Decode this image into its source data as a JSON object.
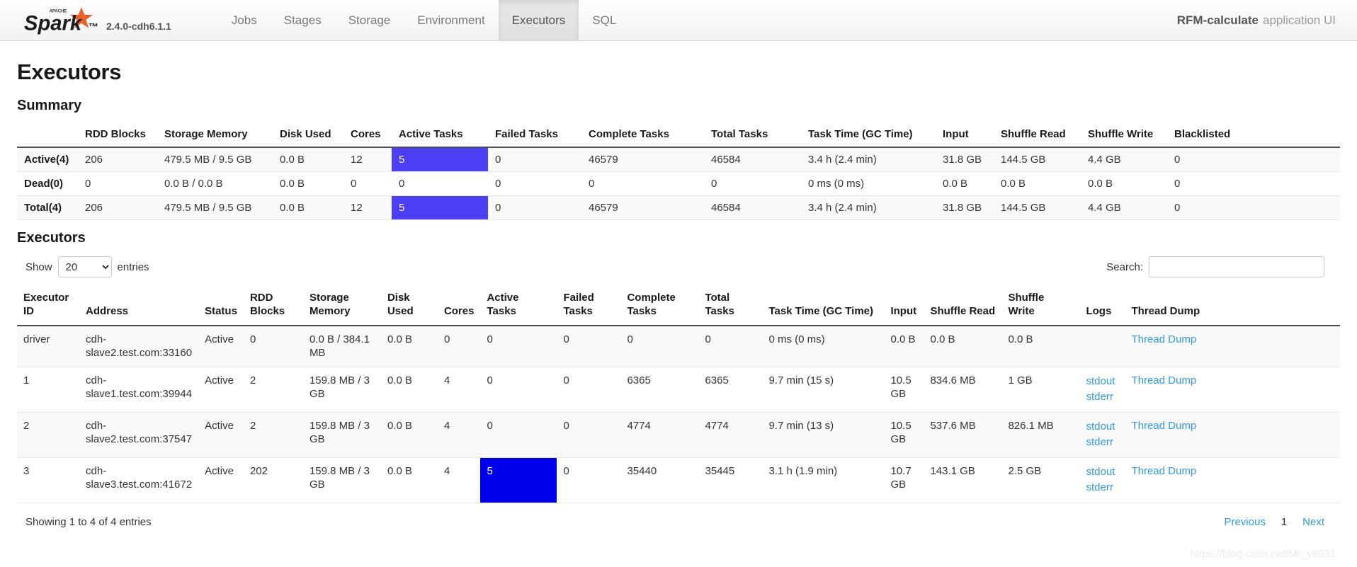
{
  "navbar": {
    "logo_alt": "Apache Spark",
    "logo_top_text": "APACHE",
    "logo_text": "Spark",
    "version": "2.4.0-cdh6.1.1",
    "items": [
      {
        "label": "Jobs",
        "active": false
      },
      {
        "label": "Stages",
        "active": false
      },
      {
        "label": "Storage",
        "active": false
      },
      {
        "label": "Environment",
        "active": false
      },
      {
        "label": "Executors",
        "active": true
      },
      {
        "label": "SQL",
        "active": false
      }
    ],
    "app_name": "RFM-calculate",
    "app_suffix": "application UI"
  },
  "page": {
    "title": "Executors",
    "summary_title": "Summary",
    "executors_title": "Executors"
  },
  "summary": {
    "headers": [
      "",
      "RDD Blocks",
      "Storage Memory",
      "Disk Used",
      "Cores",
      "Active Tasks",
      "Failed Tasks",
      "Complete Tasks",
      "Total Tasks",
      "Task Time (GC Time)",
      "Input",
      "Shuffle Read",
      "Shuffle Write",
      "Blacklisted"
    ],
    "rows": [
      {
        "label": "Active(4)",
        "rdd_blocks": "206",
        "storage_memory": "479.5 MB / 9.5 GB",
        "disk_used": "0.0 B",
        "cores": "12",
        "active_tasks": "5",
        "active_tasks_highlight": true,
        "failed_tasks": "0",
        "complete_tasks": "46579",
        "total_tasks": "46584",
        "task_time": "3.4 h (2.4 min)",
        "input": "31.8 GB",
        "shuffle_read": "144.5 GB",
        "shuffle_write": "4.4 GB",
        "blacklisted": "0"
      },
      {
        "label": "Dead(0)",
        "rdd_blocks": "0",
        "storage_memory": "0.0 B / 0.0 B",
        "disk_used": "0.0 B",
        "cores": "0",
        "active_tasks": "0",
        "active_tasks_highlight": false,
        "failed_tasks": "0",
        "complete_tasks": "0",
        "total_tasks": "0",
        "task_time": "0 ms (0 ms)",
        "input": "0.0 B",
        "shuffle_read": "0.0 B",
        "shuffle_write": "0.0 B",
        "blacklisted": "0"
      },
      {
        "label": "Total(4)",
        "rdd_blocks": "206",
        "storage_memory": "479.5 MB / 9.5 GB",
        "disk_used": "0.0 B",
        "cores": "12",
        "active_tasks": "5",
        "active_tasks_highlight": true,
        "failed_tasks": "0",
        "complete_tasks": "46579",
        "total_tasks": "46584",
        "task_time": "3.4 h (2.4 min)",
        "input": "31.8 GB",
        "shuffle_read": "144.5 GB",
        "shuffle_write": "4.4 GB",
        "blacklisted": "0"
      }
    ]
  },
  "controls": {
    "show_label": "Show",
    "entries_label": "entries",
    "page_length_selected": "20",
    "page_length_options": [
      "20",
      "40",
      "60",
      "100"
    ],
    "search_label": "Search:",
    "search_value": "",
    "search_placeholder": ""
  },
  "executors": {
    "headers": [
      "Executor ID",
      "Address",
      "Status",
      "RDD Blocks",
      "Storage Memory",
      "Disk Used",
      "Cores",
      "Active Tasks",
      "Failed Tasks",
      "Complete Tasks",
      "Total Tasks",
      "Task Time (GC Time)",
      "Input",
      "Shuffle Read",
      "Shuffle Write",
      "Logs",
      "Thread Dump"
    ],
    "rows": [
      {
        "id": "driver",
        "address": "cdh-slave2.test.com:33160",
        "status": "Active",
        "rdd_blocks": "0",
        "storage_memory": "0.0 B / 384.1 MB",
        "disk_used": "0.0 B",
        "cores": "0",
        "active_tasks": "0",
        "active_tasks_highlight": false,
        "failed_tasks": "0",
        "complete_tasks": "0",
        "total_tasks": "0",
        "task_time": "0 ms (0 ms)",
        "input": "0.0 B",
        "shuffle_read": "0.0 B",
        "shuffle_write": "0.0 B",
        "logs": [],
        "thread_dump": "Thread Dump"
      },
      {
        "id": "1",
        "address": "cdh-slave1.test.com:39944",
        "status": "Active",
        "rdd_blocks": "2",
        "storage_memory": "159.8 MB / 3 GB",
        "disk_used": "0.0 B",
        "cores": "4",
        "active_tasks": "0",
        "active_tasks_highlight": false,
        "failed_tasks": "0",
        "complete_tasks": "6365",
        "total_tasks": "6365",
        "task_time": "9.7 min (15 s)",
        "input": "10.5 GB",
        "shuffle_read": "834.6 MB",
        "shuffle_write": "1 GB",
        "logs": [
          "stdout",
          "stderr"
        ],
        "thread_dump": "Thread Dump"
      },
      {
        "id": "2",
        "address": "cdh-slave2.test.com:37547",
        "status": "Active",
        "rdd_blocks": "2",
        "storage_memory": "159.8 MB / 3 GB",
        "disk_used": "0.0 B",
        "cores": "4",
        "active_tasks": "0",
        "active_tasks_highlight": false,
        "failed_tasks": "0",
        "complete_tasks": "4774",
        "total_tasks": "4774",
        "task_time": "9.7 min (13 s)",
        "input": "10.5 GB",
        "shuffle_read": "537.6 MB",
        "shuffle_write": "826.1 MB",
        "logs": [
          "stdout",
          "stderr"
        ],
        "thread_dump": "Thread Dump"
      },
      {
        "id": "3",
        "address": "cdh-slave3.test.com:41672",
        "status": "Active",
        "rdd_blocks": "202",
        "storage_memory": "159.8 MB / 3 GB",
        "disk_used": "0.0 B",
        "cores": "4",
        "active_tasks": "5",
        "active_tasks_highlight": true,
        "failed_tasks": "0",
        "complete_tasks": "35440",
        "total_tasks": "35445",
        "task_time": "3.1 h (1.9 min)",
        "input": "10.7 GB",
        "shuffle_read": "143.1 GB",
        "shuffle_write": "2.5 GB",
        "logs": [
          "stdout",
          "stderr"
        ],
        "thread_dump": "Thread Dump"
      }
    ]
  },
  "footer": {
    "info": "Showing 1 to 4 of 4 entries",
    "previous": "Previous",
    "page_current": "1",
    "next": "Next"
  },
  "watermark": "https://blog.csdn.net/Mr_ye931",
  "colors": {
    "highlight_summary": "#4b3ef5",
    "highlight_row": "#0000ee",
    "link": "#2f9ae0",
    "nav_text": "#777777"
  }
}
